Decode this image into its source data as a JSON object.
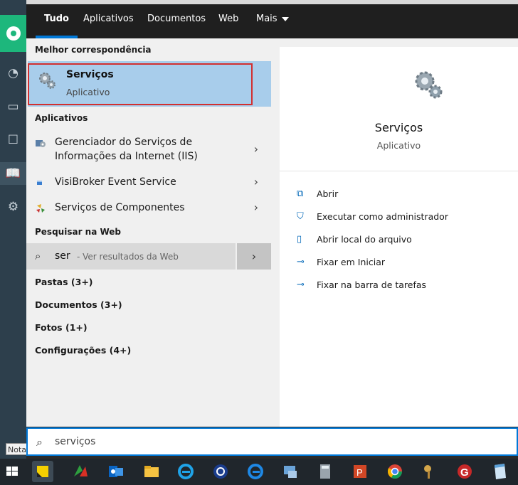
{
  "tabs": [
    {
      "label": "Tudo"
    },
    {
      "label": "Aplicativos"
    },
    {
      "label": "Documentos"
    },
    {
      "label": "Web"
    },
    {
      "label": "Mais"
    }
  ],
  "best_match": {
    "heading": "Melhor correspondência",
    "title": "Serviços",
    "subtitle": "Aplicativo"
  },
  "apps": {
    "heading": "Aplicativos",
    "items": [
      {
        "label": "Gerenciador do Serviços de Informações da Internet (IIS)"
      },
      {
        "label": "VisiBroker Event Service"
      },
      {
        "label": "Serviços de Componentes"
      }
    ]
  },
  "web_search": {
    "heading": "Pesquisar na Web",
    "query": "ser",
    "hint": "- Ver resultados da Web"
  },
  "categories": [
    {
      "label": "Pastas (3+)"
    },
    {
      "label": "Documentos (3+)"
    },
    {
      "label": "Fotos (1+)"
    },
    {
      "label": "Configurações (4+)"
    }
  ],
  "preview": {
    "title": "Serviços",
    "subtitle": "Aplicativo",
    "actions": [
      {
        "label": "Abrir",
        "icon": "open-icon"
      },
      {
        "label": "Executar como administrador",
        "icon": "shield-icon"
      },
      {
        "label": "Abrir local do arquivo",
        "icon": "file-location-icon"
      },
      {
        "label": "Fixar em Iniciar",
        "icon": "pin-icon"
      },
      {
        "label": "Fixar na barra de tarefas",
        "icon": "pin-icon"
      }
    ]
  },
  "search_box": {
    "value": "serviços"
  },
  "tooltip": {
    "text": "Nota"
  },
  "colors": {
    "accent": "#0078d7",
    "selection": "#a8cdeb",
    "highlight_border": "#d32f2f"
  }
}
